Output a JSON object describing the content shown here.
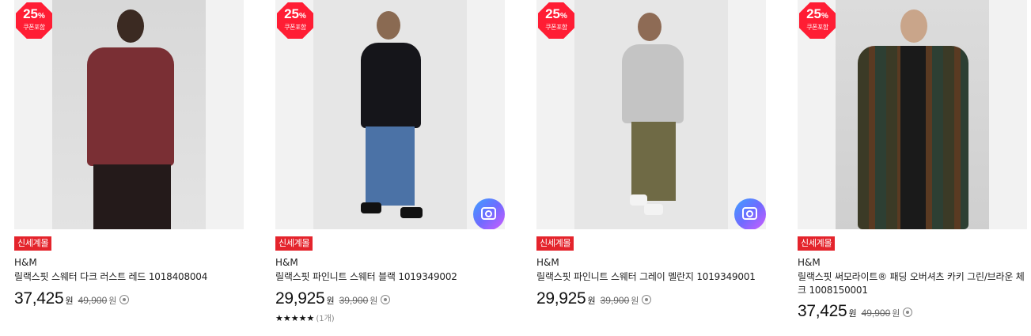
{
  "products": [
    {
      "badge": {
        "percent": "25",
        "percent_sign": "%",
        "label": "쿠폰포함"
      },
      "tag": "신세계몰",
      "brand": "H&M",
      "name": "릴랙스핏 스웨터 다크 러스트 레드 1018408004",
      "price": "37,425",
      "price_unit": "원",
      "original_price": "49,900",
      "original_unit": "원",
      "has_lens": false
    },
    {
      "badge": {
        "percent": "25",
        "percent_sign": "%",
        "label": "쿠폰포함"
      },
      "tag": "신세계몰",
      "brand": "H&M",
      "name": "릴랙스핏 파인니트 스웨터 블랙 1019349002",
      "price": "29,925",
      "price_unit": "원",
      "original_price": "39,900",
      "original_unit": "원",
      "has_lens": true,
      "rating": {
        "stars": "★★★★★",
        "count": "(1개)"
      }
    },
    {
      "badge": {
        "percent": "25",
        "percent_sign": "%",
        "label": "쿠폰포함"
      },
      "tag": "신세계몰",
      "brand": "H&M",
      "name": "릴랙스핏 파인니트 스웨터 그레이 멜란지 1019349001",
      "price": "29,925",
      "price_unit": "원",
      "original_price": "39,900",
      "original_unit": "원",
      "has_lens": true
    },
    {
      "badge": {
        "percent": "25",
        "percent_sign": "%",
        "label": "쿠폰포함"
      },
      "tag": "신세계몰",
      "brand": "H&M",
      "name": "릴랙스핏 써모라이트® 패딩 오버셔츠 카키 그린/브라운 체크 1008150001",
      "price": "37,425",
      "price_unit": "원",
      "original_price": "49,900",
      "original_unit": "원",
      "has_lens": false
    }
  ],
  "colors": {
    "badge": "#ff1d34",
    "tag": "#e4242c"
  },
  "icons": {
    "lens": "camera-lens-icon",
    "info": "info-circle-icon"
  }
}
